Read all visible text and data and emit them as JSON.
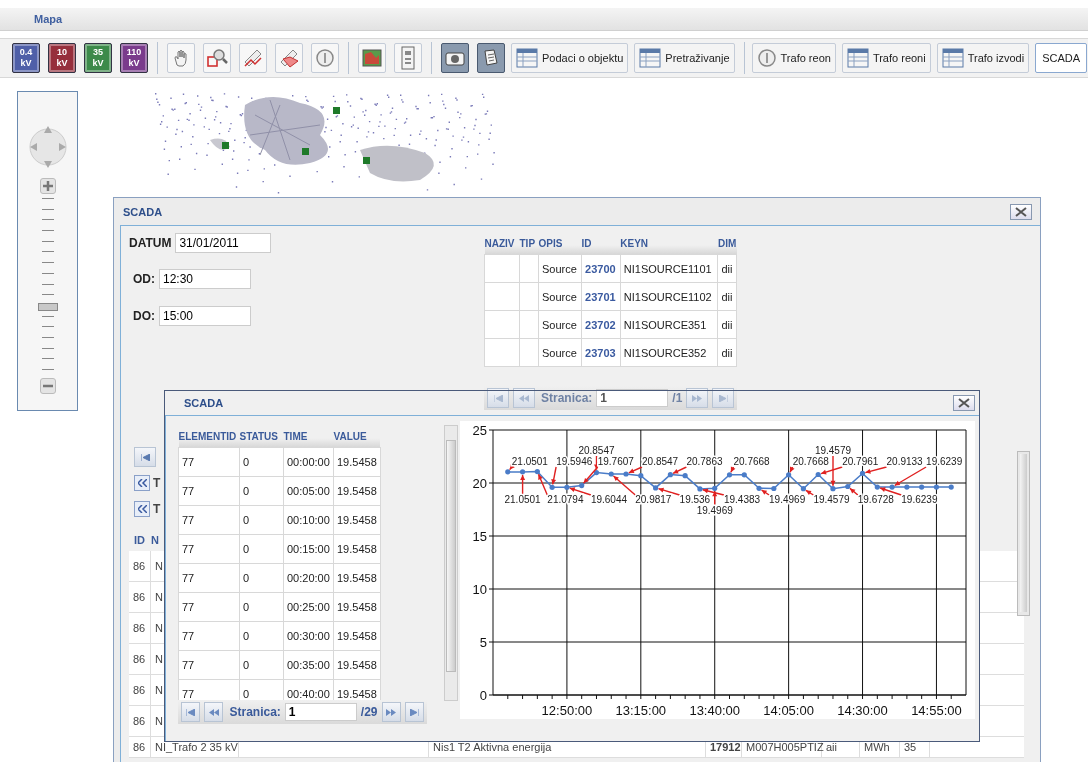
{
  "header": {
    "title": "Mapa"
  },
  "toolbar": {
    "voltage_buttons": [
      {
        "label": "0.4",
        "unit": "kV",
        "color": "#4f5fa8"
      },
      {
        "label": "10",
        "unit": "kV",
        "color": "#962f3c"
      },
      {
        "label": "35",
        "unit": "kV",
        "color": "#3c8a4a"
      },
      {
        "label": "110",
        "unit": "kV",
        "color": "#7a3b8c"
      }
    ],
    "text_buttons": [
      {
        "label": "Podaci o objektu",
        "kind": "table",
        "separator_before": false
      },
      {
        "label": "Pretraživanje",
        "kind": "table",
        "separator_before": false
      },
      {
        "label": "Trafo reon",
        "kind": "circle",
        "separator_before": true
      },
      {
        "label": "Trafo reoni",
        "kind": "table",
        "separator_before": false
      },
      {
        "label": "Trafo izvodi",
        "kind": "table",
        "separator_before": false
      },
      {
        "label": "SCADA",
        "kind": "plain",
        "separator_before": false
      }
    ]
  },
  "zoom_control": {
    "level": 0.35
  },
  "scada_window": {
    "title": "SCADA",
    "fields": [
      {
        "label": "DATUM",
        "value": "31/01/2011"
      },
      {
        "label": "OD:",
        "value": "12:30"
      },
      {
        "label": "DO:",
        "value": "15:00"
      }
    ],
    "table": {
      "columns": [
        "NAZIV",
        "TIP",
        "OPIS",
        "ID",
        "KEYN",
        "DIM"
      ],
      "rows": [
        {
          "opis": "Source",
          "id": "23700",
          "keyn": "NI1SOURCE1101",
          "dim": "dii"
        },
        {
          "opis": "Source",
          "id": "23701",
          "keyn": "NI1SOURCE1102",
          "dim": "dii"
        },
        {
          "opis": "Source",
          "id": "23702",
          "keyn": "NI1SOURCE351",
          "dim": "dii"
        },
        {
          "opis": "Source",
          "id": "23703",
          "keyn": "NI1SOURCE352",
          "dim": "dii"
        }
      ]
    },
    "pager": {
      "label": "Stranica:",
      "value": "1",
      "total": "/1",
      "disabled": true
    },
    "lower_grid": {
      "links": [
        "T",
        "T"
      ],
      "columns": [
        "ID",
        "N"
      ],
      "rows": [
        {
          "column_1": "86",
          "column_2": "N"
        },
        {
          "column_1": "86",
          "column_2": "N"
        },
        {
          "column_1": "86",
          "column_2": "N"
        },
        {
          "column_1": "86",
          "column_2": "N"
        },
        {
          "column_1": "86",
          "column_2": "N"
        },
        {
          "column_1": "86",
          "column_2": "N"
        },
        {
          "column_1": "86",
          "column_2": "NI_Trafo 2 35 kV",
          "column_4": "Nis1 T2 Aktivna energija",
          "column_5": "17912",
          "column_6": "M007H005PTIZ",
          "column_7": "aii",
          "column_8": "MWh",
          "column_9": "35"
        }
      ]
    }
  },
  "chart_window": {
    "title": "SCADA",
    "table": {
      "columns": [
        "ELEMENTID",
        "STATUS",
        "TIME",
        "VALUE"
      ],
      "rows": [
        [
          "77",
          "0",
          "00:00:00",
          "19.5458"
        ],
        [
          "77",
          "0",
          "00:05:00",
          "19.5458"
        ],
        [
          "77",
          "0",
          "00:10:00",
          "19.5458"
        ],
        [
          "77",
          "0",
          "00:15:00",
          "19.5458"
        ],
        [
          "77",
          "0",
          "00:20:00",
          "19.5458"
        ],
        [
          "77",
          "0",
          "00:25:00",
          "19.5458"
        ],
        [
          "77",
          "0",
          "00:30:00",
          "19.5458"
        ],
        [
          "77",
          "0",
          "00:35:00",
          "19.5458"
        ],
        [
          "77",
          "0",
          "00:40:00",
          "19.5458"
        ]
      ]
    },
    "pager": {
      "label": "Stranica:",
      "value": "1",
      "total": "/29",
      "disabled": false
    },
    "chart_data": {
      "type": "line",
      "grid": true,
      "x": [
        750,
        755,
        760,
        765,
        770,
        775,
        780,
        785,
        790,
        795,
        800,
        805,
        810,
        815,
        820,
        825,
        830,
        835,
        840,
        845,
        850,
        855,
        860,
        865,
        870,
        875,
        880,
        885,
        890,
        895,
        900
      ],
      "series": [
        {
          "color": "#4a7cc8",
          "values": [
            21.05,
            21.05,
            21.08,
            19.59,
            19.6,
            19.76,
            20.98,
            20.85,
            20.85,
            20.69,
            19.54,
            20.79,
            20.69,
            19.44,
            19.5,
            20.77,
            20.77,
            19.5,
            19.48,
            20.77,
            19.46,
            20.8,
            19.46,
            19.67,
            20.91,
            19.62,
            19.62,
            19.62,
            19.62,
            19.62,
            19.62
          ]
        }
      ],
      "xlim": [
        745,
        905
      ],
      "ylim": [
        0,
        25
      ],
      "xticks": [
        {
          "value": 770,
          "label": "12:50:00"
        },
        {
          "value": 795,
          "label": "13:15:00"
        },
        {
          "value": 820,
          "label": "13:40:00"
        },
        {
          "value": 845,
          "label": "14:05:00"
        },
        {
          "value": 870,
          "label": "14:30:00"
        },
        {
          "value": 895,
          "label": "14:55:00"
        }
      ],
      "yticks": [
        {
          "value": 0,
          "label": "0"
        },
        {
          "value": 5,
          "label": "5"
        },
        {
          "value": 10,
          "label": "10"
        },
        {
          "value": 15,
          "label": "15"
        },
        {
          "value": 20,
          "label": "20"
        },
        {
          "value": 25,
          "label": "25"
        }
      ],
      "annotations": [
        {
          "x": 750,
          "y": 21.05,
          "text": "21.0501"
        },
        {
          "x": 755,
          "y": 21.05,
          "text": "21.0501"
        },
        {
          "x": 760,
          "y": 21.08,
          "text": "21.0794"
        },
        {
          "x": 765,
          "y": 19.59,
          "text": "19.5946"
        },
        {
          "x": 770,
          "y": 19.6,
          "text": "19.6044"
        },
        {
          "x": 775,
          "y": 19.76,
          "text": "19.7607"
        },
        {
          "x": 780,
          "y": 20.98,
          "text": "20.8547"
        },
        {
          "x": 785,
          "y": 20.85,
          "text": "20.9817"
        },
        {
          "x": 790,
          "y": 20.85,
          "text": "20.8547"
        },
        {
          "x": 800,
          "y": 19.54,
          "text": "19.536"
        },
        {
          "x": 805,
          "y": 20.79,
          "text": "20.7863"
        },
        {
          "x": 815,
          "y": 19.44,
          "text": "19.4383"
        },
        {
          "x": 820,
          "y": 19.5,
          "text": "19.4969"
        },
        {
          "x": 825,
          "y": 20.77,
          "text": "20.7668"
        },
        {
          "x": 835,
          "y": 19.5,
          "text": "19.4969"
        },
        {
          "x": 845,
          "y": 20.77,
          "text": "20.7668"
        },
        {
          "x": 850,
          "y": 19.46,
          "text": "19.4579"
        },
        {
          "x": 855,
          "y": 20.8,
          "text": "20.7961"
        },
        {
          "x": 860,
          "y": 19.46,
          "text": "19.4579"
        },
        {
          "x": 865,
          "y": 19.67,
          "text": "19.6728"
        },
        {
          "x": 870,
          "y": 20.91,
          "text": "20.9133"
        },
        {
          "x": 875,
          "y": 19.62,
          "text": "19.6239"
        },
        {
          "x": 880,
          "y": 19.62,
          "text": "19.6239"
        }
      ]
    }
  }
}
